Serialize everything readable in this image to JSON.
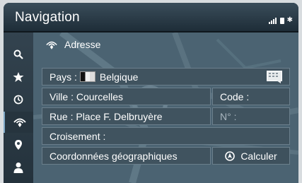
{
  "header": {
    "title": "Navigation"
  },
  "status_icons": [
    "signal-icon",
    "phone-icon",
    "bluetooth-icon"
  ],
  "sidebar": {
    "items": [
      {
        "icon": "search-icon"
      },
      {
        "icon": "star-icon"
      },
      {
        "icon": "history-icon"
      },
      {
        "icon": "address-icon",
        "active": true
      },
      {
        "icon": "pin-icon"
      },
      {
        "icon": "contact-icon"
      }
    ]
  },
  "panel": {
    "heading": "Adresse",
    "country_prefix": "Pays :",
    "country_value": "Belgique",
    "city": "Ville : Courcelles",
    "postcode": "Code :",
    "street": "Rue : Place F. Delbruyère",
    "house_number": "N° :",
    "crossing": "Croisement :",
    "coordinates": "Coordonnées géographiques",
    "calculate": "Calculer"
  }
}
